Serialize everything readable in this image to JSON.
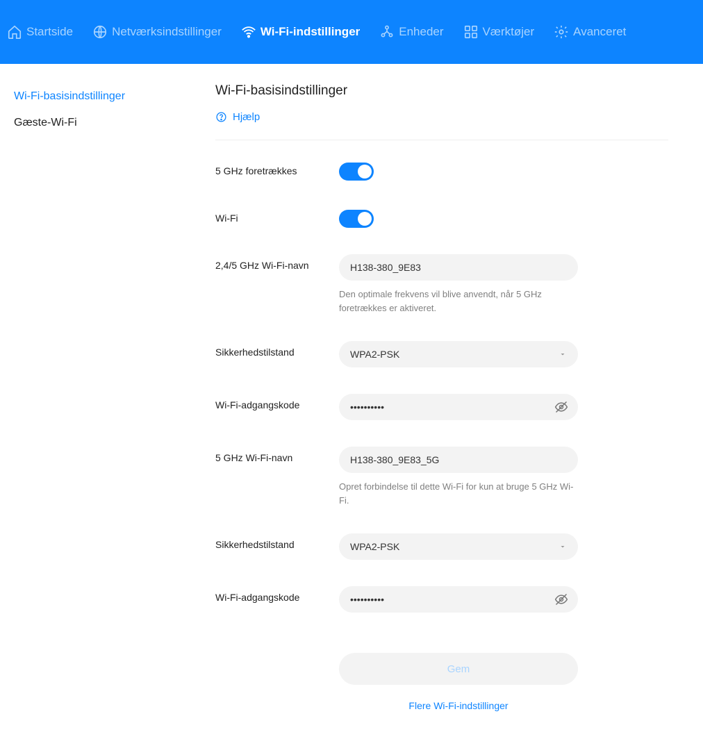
{
  "nav": {
    "home": "Startside",
    "network": "Netværksindstillinger",
    "wifi": "Wi-Fi-indstillinger",
    "devices": "Enheder",
    "tools": "Værktøjer",
    "advanced": "Avanceret"
  },
  "sidebar": {
    "basic": "Wi-Fi-basisindstillinger",
    "guest": "Gæste-Wi-Fi"
  },
  "page": {
    "title": "Wi-Fi-basisindstillinger",
    "help": "Hjælp"
  },
  "form": {
    "prefer5_label": "5 GHz foretrækkes",
    "wifi_label": "Wi-Fi",
    "ssid24_label": "2,4/5 GHz Wi-Fi-navn",
    "ssid24_value": "H138-380_9E83",
    "ssid24_hint": "Den optimale frekvens vil blive anvendt, når 5 GHz foretrækkes er aktiveret.",
    "sec_label": "Sikkerhedstilstand",
    "sec_value": "WPA2-PSK",
    "pw_label": "Wi-Fi-adgangskode",
    "pw_value": "••••••••••",
    "ssid5_label": "5 GHz Wi-Fi-navn",
    "ssid5_value": "H138-380_9E83_5G",
    "ssid5_hint": "Opret forbindelse til dette Wi-Fi for kun at bruge 5 GHz Wi-Fi.",
    "save": "Gem",
    "more": "Flere Wi-Fi-indstillinger"
  }
}
